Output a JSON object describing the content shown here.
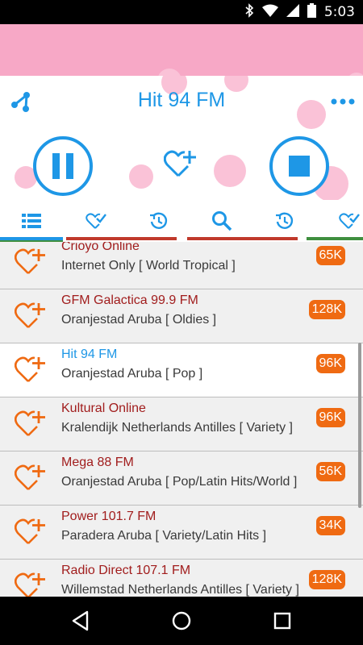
{
  "status_bar": {
    "time": "5:03",
    "icons": [
      "bluetooth-icon",
      "wifi-icon",
      "signal-icon",
      "battery-icon"
    ]
  },
  "player": {
    "station_title": "Hit 94 FM",
    "accent_color": "#1e97e6",
    "icons": [
      "share-icon",
      "more-icon",
      "pause-icon",
      "favorite-add-icon",
      "stop-icon"
    ]
  },
  "tabs": [
    {
      "name": "list-tab",
      "icon": "list-icon",
      "underline": "#1e97e6"
    },
    {
      "name": "favorites-tab",
      "icon": "heart-check-icon",
      "underline": "#c0392b"
    },
    {
      "name": "history-tab",
      "icon": "history-icon",
      "underline": "#ffffff"
    },
    {
      "name": "search-tab",
      "icon": "search-icon",
      "underline": "#c0392b"
    },
    {
      "name": "recent-tab",
      "icon": "history-icon",
      "underline": "#ffffff"
    },
    {
      "name": "favorites-tab-2",
      "icon": "heart-check-icon",
      "underline": "#3f8f3f"
    }
  ],
  "stations": [
    {
      "name": "Crioyo Online",
      "location": "Internet Only [ World Tropical ]",
      "bitrate": "65K"
    },
    {
      "name": "GFM Galactica 99.9 FM",
      "location": "Oranjestad Aruba [ Oldies ]",
      "bitrate": "128K"
    },
    {
      "name": "Hit 94 FM",
      "location": "Oranjestad Aruba [ Pop ]",
      "bitrate": "96K",
      "active": true
    },
    {
      "name": "Kultural Online",
      "location": "Kralendijk Netherlands Antilles [ Variety ]",
      "bitrate": "96K"
    },
    {
      "name": "Mega 88 FM",
      "location": "Oranjestad Aruba [ Pop/Latin Hits/World ]",
      "bitrate": "56K"
    },
    {
      "name": "Power 101.7 FM",
      "location": "Paradera Aruba [ Variety/Latin Hits ]",
      "bitrate": "34K"
    },
    {
      "name": "Radio Direct 107.1 FM",
      "location": "Willemstad Netherlands Antilles [ Variety ]",
      "bitrate": "128K"
    }
  ],
  "colors": {
    "banner": "#f7a8c6",
    "station_name": "#a11d1d",
    "badge": "#ef6a12"
  },
  "nav": [
    "back-icon",
    "home-icon",
    "recents-icon"
  ]
}
